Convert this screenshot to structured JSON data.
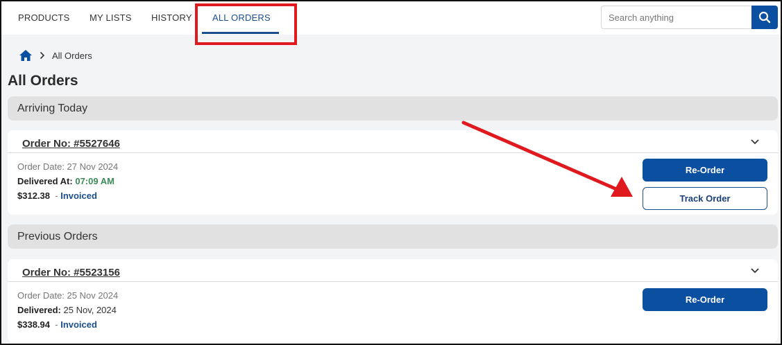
{
  "nav": {
    "items": [
      {
        "label": "PRODUCTS"
      },
      {
        "label": "MY LISTS"
      },
      {
        "label": "HISTORY"
      },
      {
        "label": "ALL ORDERS"
      }
    ],
    "active_index": 3
  },
  "search": {
    "placeholder": "Search anything",
    "value": "",
    "icon": "search-icon"
  },
  "breadcrumb": {
    "home_icon": "home-icon",
    "current": "All Orders"
  },
  "page_title": "All Orders",
  "sections": [
    {
      "label": "Arriving Today",
      "orders": [
        {
          "order_no": "Order No: #5527646",
          "order_date": "Order Date: 27 Nov 2024",
          "delivered_label": "Delivered At:",
          "delivered_value": "07:09 AM",
          "amount": "$312.38",
          "status": "Invoiced",
          "buttons": {
            "reorder": "Re-Order",
            "track": "Track Order"
          }
        }
      ]
    },
    {
      "label": "Previous Orders",
      "orders": [
        {
          "order_no": "Order No: #5523156",
          "order_date": "Order Date: 25 Nov 2024",
          "delivered_label": "Delivered:",
          "delivered_value": "25 Nov, 2024",
          "amount": "$338.94",
          "status": "Invoiced",
          "buttons": {
            "reorder": "Re-Order"
          }
        }
      ]
    }
  ],
  "colors": {
    "brand": "#0b4fa0",
    "annotation": "#e0191e",
    "delivered_time": "#3d8a5a"
  }
}
